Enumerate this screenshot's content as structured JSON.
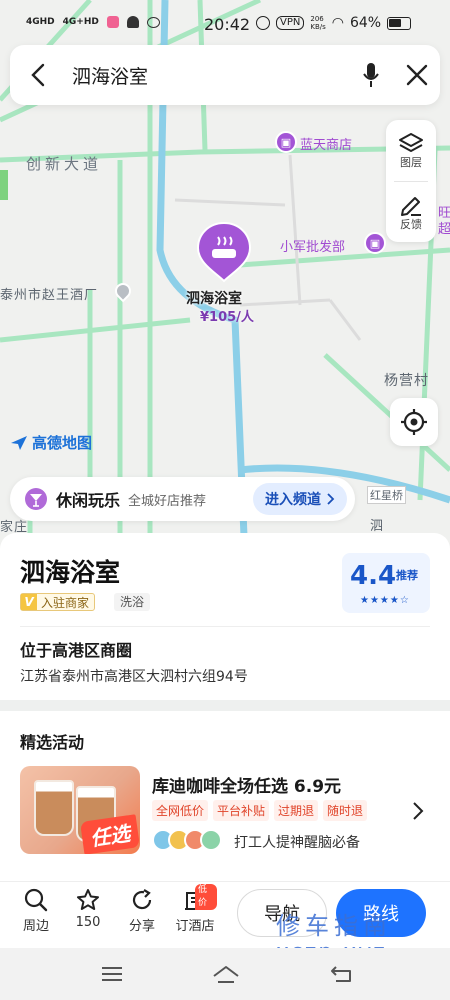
{
  "status_bar": {
    "signal1": "4GHD",
    "signal2": "4G+HD",
    "time": "20:42",
    "vpn": "VPN",
    "speed_value": "206",
    "speed_unit": "KB/s",
    "battery": "64%"
  },
  "search": {
    "query": "泗海浴室"
  },
  "map": {
    "road_main": "创新大道",
    "poi_store": "蓝天商店",
    "poi_wholesale": "小军批发部",
    "factory": "泰州市赵王酒厂",
    "village": "杨营村",
    "bridge": "红星桥",
    "edge_left": "家庄",
    "edge_bottom": "泗",
    "edge_right": "旺超",
    "logo": "高德地图",
    "colors": {
      "road": "#9ee3b8",
      "water": "#8ccfe8",
      "accent": "#a355d6"
    }
  },
  "marker": {
    "name": "泗海浴室",
    "price": "¥105/人",
    "icon": "bath-icon"
  },
  "tools": {
    "layers": "图层",
    "feedback": "反馈"
  },
  "leisure": {
    "title": "休闲玩乐",
    "subtitle": "全城好店推荐",
    "enter": "进入频道"
  },
  "place": {
    "name": "泗海浴室",
    "merchant_badge": "入驻商家",
    "merchant_v": "V",
    "category": "洗浴",
    "rating": "4.4",
    "rating_label": "推荐",
    "stars": "★★★★☆",
    "area": "位于高港区商圈",
    "address": "江苏省泰州市高港区大泗村六组94号"
  },
  "activity": {
    "section_title": "精选活动",
    "promo_tag": "任选",
    "title": "库迪咖啡全场任选 6.9元",
    "tags": [
      "全网低价",
      "平台补贴",
      "过期退",
      "随时退"
    ],
    "desc": "打工人提神醒脑必备"
  },
  "actions": {
    "nearby": "周边",
    "favorites": "150",
    "share": "分享",
    "hotel": "订酒店",
    "hotel_badge": "低价",
    "navigate": "导航",
    "route": "路线"
  },
  "watermark": {
    "line1": "修车指南",
    "line2": "xczn.xyz"
  }
}
